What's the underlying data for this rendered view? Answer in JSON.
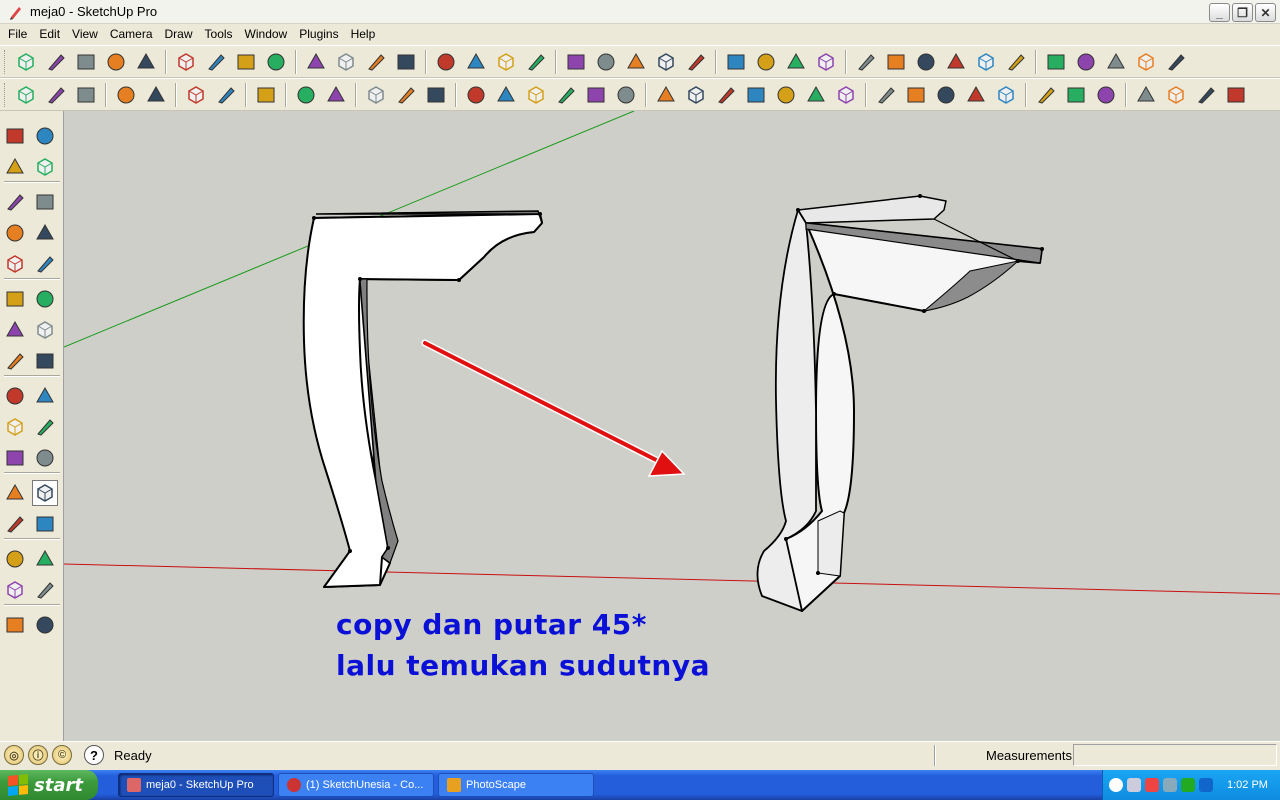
{
  "window": {
    "title": "meja0 - SketchUp Pro",
    "controls": [
      "minimize",
      "restore",
      "close"
    ]
  },
  "menu": [
    "File",
    "Edit",
    "View",
    "Camera",
    "Draw",
    "Tools",
    "Window",
    "Plugins",
    "Help"
  ],
  "toolbar1": [
    "select-icon",
    "pencil-icon",
    "rectangle-icon",
    "circle-icon",
    "arc-icon",
    "make-component-icon",
    "eraser-icon",
    "tape-measure-icon",
    "paint-bucket-icon",
    "push-pull-icon",
    "move-icon",
    "rotate-icon",
    "follow-me-icon",
    "orbit-icon",
    "pan-icon",
    "zoom-icon",
    "zoom-extents-icon",
    "get-models-icon",
    "share-model-icon",
    "place-model-icon",
    "preview-model-icon",
    "google-earth-icon",
    "import-icon",
    "export-icon",
    "component-icon",
    "xray-icon",
    "back-edges-icon",
    "wireframe-icon",
    "hidden-line-icon",
    "shaded-icon",
    "shaded-texture-icon",
    "monochrome-icon",
    "iso-view-icon",
    "top-view-icon",
    "front-view-icon",
    "right-view-icon",
    "back-view-icon"
  ],
  "toolbar2": [
    "new-icon",
    "open-icon",
    "save-icon",
    "model-info-icon",
    "walk-icon",
    "print-icon",
    "paste-icon",
    "delete-icon",
    "undo-icon",
    "redo-icon",
    "section-plane-icon",
    "section-display-icon",
    "section-cut-icon",
    "iso-house-icon",
    "door-icon",
    "front-house-icon",
    "back-house-icon",
    "side-house-icon",
    "roof-icon",
    "xray-cube-icon",
    "back-edges-cube-icon",
    "wireframe-cube-icon",
    "hidden-cube-icon",
    "shaded-cube-icon",
    "texture-cube-icon",
    "monochrome-cube-icon",
    "solid-box-icon",
    "color-box-icon",
    "dark-box-icon",
    "info-box-icon",
    "cylinder-icon",
    "axes-icon",
    "boxes-icon",
    "layers-icon",
    "compass-icon",
    "sandbox-contour-icon",
    "sandbox-scratch-icon",
    "sandbox-smoove-icon"
  ],
  "left_tools": [
    "select-icon",
    "component-icon",
    "paint-bucket-icon",
    "eraser-icon",
    "rectangle-icon",
    "line-icon",
    "circle-icon",
    "arc-icon",
    "polygon-icon",
    "freehand-icon",
    "move-icon",
    "push-pull-icon",
    "rotate-icon",
    "follow-me-icon",
    "scale-icon",
    "offset-icon",
    "tape-measure-icon",
    "dimension-icon",
    "protractor-icon",
    "text-icon",
    "axes-icon",
    "3d-text-icon",
    "orbit-icon",
    "pan-icon",
    "zoom-icon",
    "zoom-window-icon",
    "previous-view-icon",
    "next-view-icon",
    "position-camera-icon",
    "look-around-icon",
    "walk-icon",
    "section-plane-icon"
  ],
  "viewport": {
    "background": "#cfcfc9",
    "caption_line1": "copy dan putar 45*",
    "caption_line2": "lalu temukan sudutnya",
    "caption_color": "#0a10d6",
    "arrow_color": "#e01010"
  },
  "status": {
    "message": "Ready",
    "measurements_label": "Measurements",
    "measurements_value": ""
  },
  "taskbar": {
    "start_label": "start",
    "tasks": [
      {
        "label": "meja0 - SketchUp Pro",
        "active": true
      },
      {
        "label": "(1) SketchUnesia - Co...",
        "active": false
      },
      {
        "label": "PhotoScape",
        "active": false
      }
    ],
    "clock": "1:02 PM"
  }
}
